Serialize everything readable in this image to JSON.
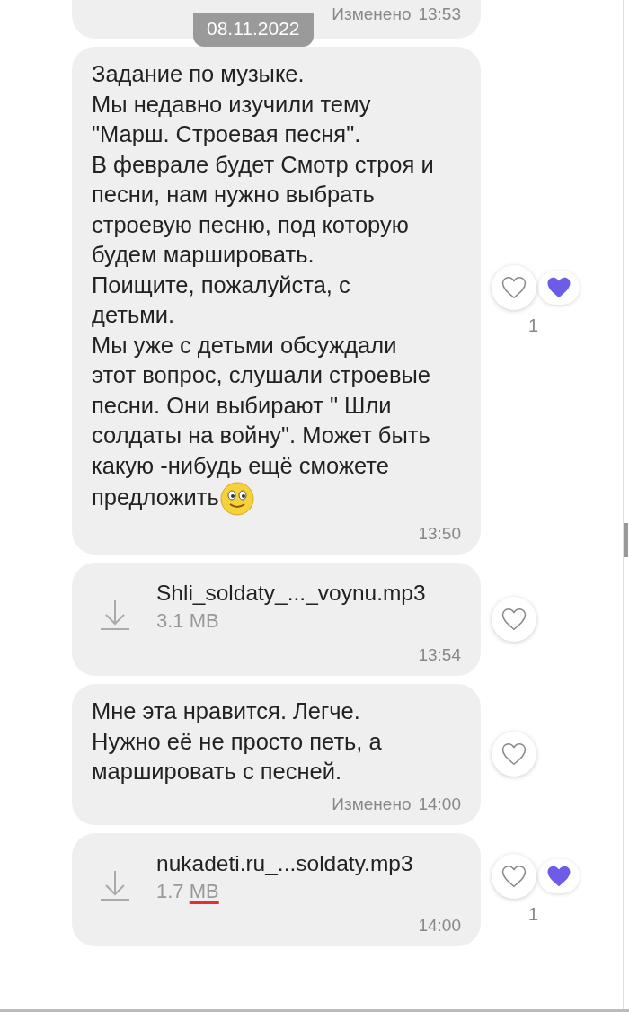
{
  "date_pill": "08.11.2022",
  "top_message": {
    "edited": "Изменено",
    "time": "13:53"
  },
  "messages": [
    {
      "kind": "text",
      "text": "Задание по музыке.\nМы недавно изучили тему \"Марш. Строевая песня\".\nВ феврале будет Смотр строя и песни, нам нужно выбрать строевую песню, под которую будем маршировать.\nПоищите, пожалуйста, с детьми.\nМы уже с детьми обсуждали этот вопрос, слушали строевые песни. Они выбирают \" Шли солдаты на войну\". Может быть какую -нибудь ещё сможете предложить",
      "emoji": true,
      "time": "13:50",
      "liked": true,
      "like_count": "1"
    },
    {
      "kind": "file",
      "file_name": "Shli_soldaty_..._voynu.mp3",
      "size": "3.1 MB",
      "time": "13:54",
      "liked": false
    },
    {
      "kind": "text",
      "text": "Мне эта нравится. Легче. Нужно её не просто петь, а маршировать с песней.",
      "edited": "Изменено",
      "time": "14:00",
      "liked": false
    },
    {
      "kind": "file",
      "file_name": "nukadeti.ru_...soldaty.mp3",
      "size": "1.7 MB",
      "spellcheck": true,
      "time": "14:00",
      "liked": true,
      "like_count": "1"
    }
  ]
}
